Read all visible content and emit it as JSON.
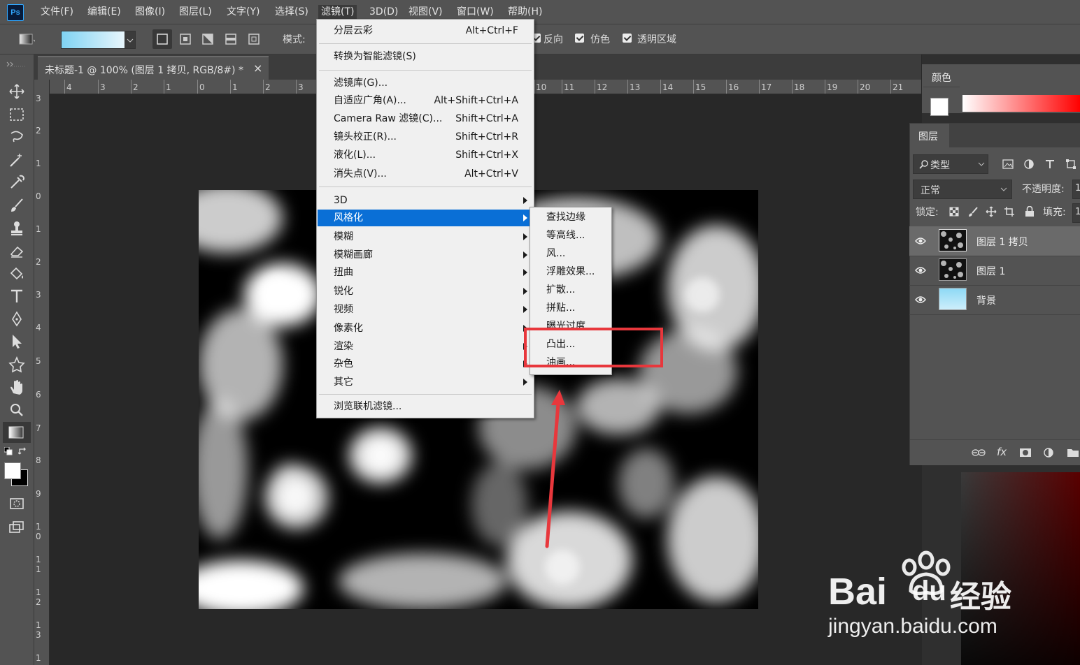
{
  "app": {
    "logo": "Ps"
  },
  "menubar": {
    "items": [
      "文件(F)",
      "编辑(E)",
      "图像(I)",
      "图层(L)",
      "文字(Y)",
      "选择(S)",
      "滤镜(T)",
      "3D(D)",
      "视图(V)",
      "窗口(W)",
      "帮助(H)"
    ],
    "active_index": 6
  },
  "options_bar": {
    "mode_label": "模式:",
    "reverse_label": "反向",
    "dither_label": "仿色",
    "transparency_label": "透明区域"
  },
  "document": {
    "tab_title": "未标题-1 @ 100% (图层 1 拷贝, RGB/8#) *",
    "close": "×",
    "ruler_h": [
      "4",
      "3",
      "2",
      "1",
      "0",
      "1",
      "2",
      "3",
      "10",
      "11",
      "12",
      "13",
      "14",
      "15",
      "16",
      "17",
      "18",
      "19",
      "20",
      "21"
    ],
    "ruler_v": [
      "3",
      "2",
      "1",
      "0",
      "1",
      "2",
      "3",
      "4",
      "5",
      "6",
      "7",
      "8",
      "9",
      "10",
      "11",
      "12",
      "13",
      "1"
    ]
  },
  "filter_menu": {
    "last_filter": {
      "label": "分层云彩",
      "shortcut": "Alt+Ctrl+F"
    },
    "convert_smart": {
      "label": "转换为智能滤镜(S)"
    },
    "group1": [
      {
        "label": "滤镜库(G)...",
        "shortcut": ""
      },
      {
        "label": "自适应广角(A)...",
        "shortcut": "Alt+Shift+Ctrl+A"
      },
      {
        "label": "Camera Raw 滤镜(C)...",
        "shortcut": "Shift+Ctrl+A"
      },
      {
        "label": "镜头校正(R)...",
        "shortcut": "Shift+Ctrl+R"
      },
      {
        "label": "液化(L)...",
        "shortcut": "Shift+Ctrl+X"
      },
      {
        "label": "消失点(V)...",
        "shortcut": "Alt+Ctrl+V"
      }
    ],
    "submenus": [
      "3D",
      "风格化",
      "模糊",
      "模糊画廊",
      "扭曲",
      "锐化",
      "视频",
      "像素化",
      "渲染",
      "杂色",
      "其它"
    ],
    "highlighted_submenu": "风格化",
    "browse_online": {
      "label": "浏览联机滤镜..."
    }
  },
  "stylize_submenu": {
    "items": [
      "查找边缘",
      "等高线...",
      "风...",
      "浮雕效果...",
      "扩散...",
      "拼贴...",
      "曝光过度",
      "凸出...",
      "油画..."
    ],
    "highlighted": "凸出..."
  },
  "panels": {
    "color_tab": "颜色",
    "layers_tab": "图层",
    "filter_kind": "类型",
    "blend_mode": "正常",
    "opacity_label": "不透明度:",
    "opacity_value": "1",
    "lock_label": "锁定:",
    "fill_label": "填充:",
    "fill_value": "1",
    "layers": [
      {
        "name": "图层 1 拷贝",
        "selected": true
      },
      {
        "name": "图层 1",
        "selected": false
      },
      {
        "name": "背景",
        "selected": false
      }
    ]
  },
  "watermark": {
    "brand": "Bai",
    "brand2": "du",
    "brand_cn": "经验",
    "url": "jingyan.baidu.com"
  },
  "colors": {
    "menu_highlight": "#0a6fd6",
    "annotation_red": "#e8373c",
    "ps_blue": "#31a8ff"
  }
}
